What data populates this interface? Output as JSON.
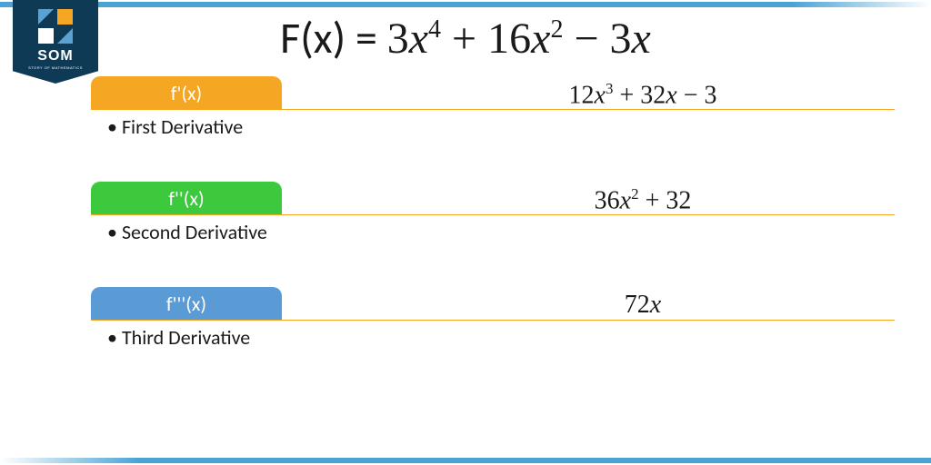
{
  "logo": {
    "text": "SOM",
    "subtext": "STORY OF MATHEMATICS"
  },
  "title": {
    "fx": "F(x) = ",
    "c1": "3",
    "v1": "x",
    "e1": "4",
    "op1": " + ",
    "c2": "16",
    "v2": "x",
    "e2": "2",
    "op2": " − ",
    "c3": "3",
    "v3": "x"
  },
  "derivatives": [
    {
      "label": "f'(x)",
      "desc": "First Derivative",
      "expr_c1": "12",
      "expr_v1": "x",
      "expr_e1": "3",
      "expr_op1": " + ",
      "expr_c2": "32",
      "expr_v2": "x",
      "expr_op2": " − ",
      "expr_c3": "3"
    },
    {
      "label": "f''(x)",
      "desc": "Second Derivative",
      "expr_c1": "36",
      "expr_v1": "x",
      "expr_e1": "2",
      "expr_op1": " + ",
      "expr_c2": "32"
    },
    {
      "label": "f'''(x)",
      "desc": "Third Derivative",
      "expr_c1": "72",
      "expr_v1": "x"
    }
  ]
}
